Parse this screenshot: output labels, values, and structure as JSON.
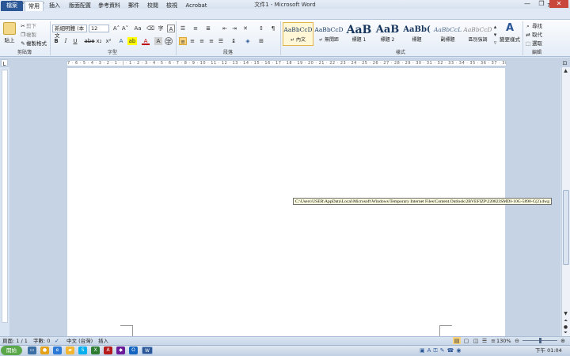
{
  "window": {
    "title": "文件1 - Microsoft Word"
  },
  "qat": {
    "save": "💾",
    "undo": "↶",
    "redo": "↷",
    "more": "▾"
  },
  "window_controls": {
    "minimize": "—",
    "restore": "❐",
    "close": "✕"
  },
  "tabs": [
    "檔案",
    "常用",
    "插入",
    "版面配置",
    "參考資料",
    "郵件",
    "校閱",
    "檢視",
    "Acrobat"
  ],
  "clipboard": {
    "paste": "貼上",
    "cut": "剪下",
    "copy": "複製",
    "format_painter": "複製格式",
    "label": "剪貼簿"
  },
  "font": {
    "name": "新細明體 (本文",
    "size": "12",
    "grow": "A˄",
    "shrink": "A˅",
    "clear": "Aa",
    "bold": "B",
    "italic": "I",
    "underline": "U",
    "strike": "abe",
    "subscript": "x₂",
    "superscript": "x²",
    "highlight": "ab",
    "color": "A",
    "label": "字型"
  },
  "paragraph": {
    "label": "段落"
  },
  "styles": {
    "label": "樣式",
    "items": [
      {
        "sample": "AaBbCcD",
        "name": "↵ 內文",
        "selected": true
      },
      {
        "sample": "AaBbCcD",
        "name": "↵ 無間距"
      },
      {
        "sample": "AaB",
        "name": "標題 1"
      },
      {
        "sample": "AaB",
        "name": "標題 2"
      },
      {
        "sample": "AaBb(",
        "name": "標題"
      },
      {
        "sample": "AaBbCcL",
        "name": "副標題"
      },
      {
        "sample": "AaBbCcD",
        "name": "區別強調"
      }
    ],
    "change": "變更樣式"
  },
  "editing": {
    "label": "編輯",
    "find": "尋找",
    "replace": "取代",
    "select": "選取"
  },
  "ruler": {
    "marks": "7 · 6 · 5 · 4 · 3 · 2 · 1 · | · 1 · 2 · 3 · 4 · 5 · 6 · 7 · 8 · 9 · 10 · 11 · 12 · 13 · 14 · 15 · 16 · 17 · 18 · 19 · 20 · 21 · 22 · 23 · 24 · 25 · 26 · 27 · 28 · 29 · 30 · 31 · 32 · 33 · 34 · 35 · 36 · 37 · 38 · 39 · 40 · 41 · 42"
  },
  "document": {
    "tooltip": "C:\\Users\\USER\\AppData\\Local\\Microsoft\\Windows\\Temporary Internet Files\\Content.Outlook\\2BVEFIZP\\220823SMDI-10G-5890-C(2).dwg"
  },
  "statusbar": {
    "page": "頁面: 1 / 1",
    "words": "字數: 0",
    "language": "中文 (台灣)",
    "mode": "插入",
    "zoom": "130%"
  },
  "taskbar": {
    "start": "開始",
    "time": "下午 01:04"
  }
}
